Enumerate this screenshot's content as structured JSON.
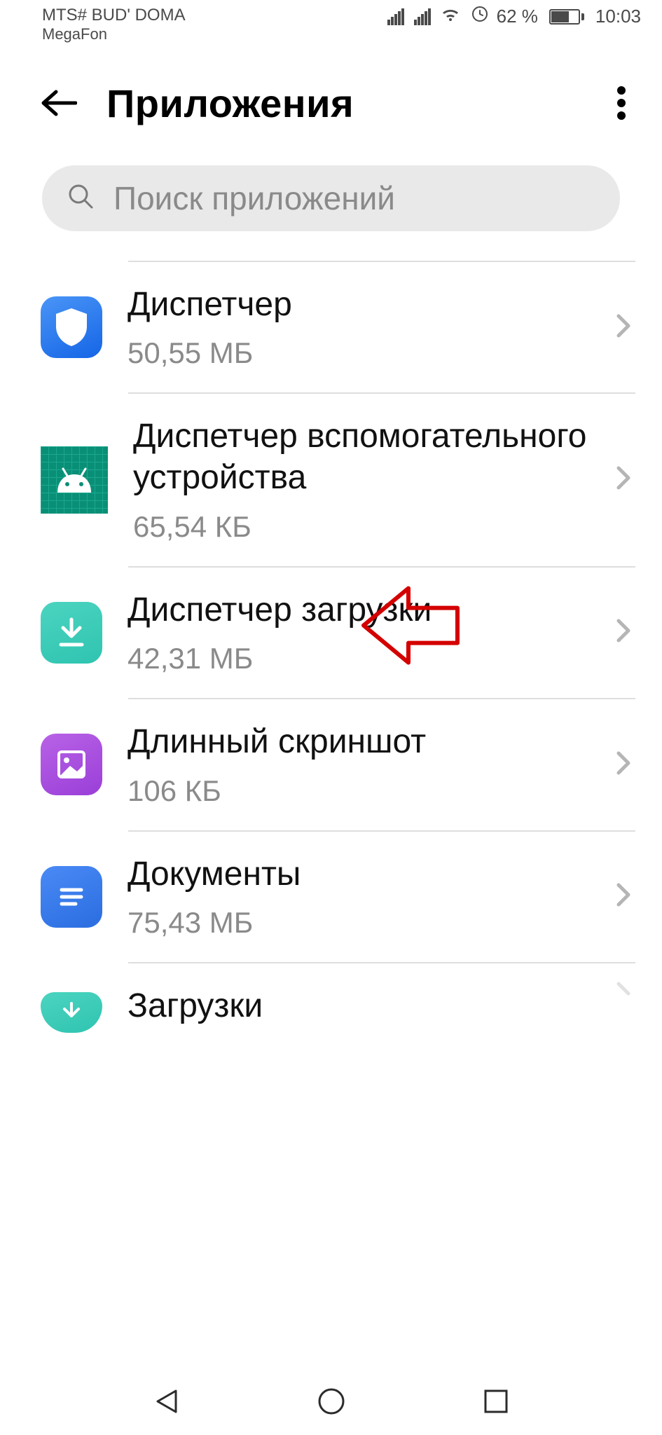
{
  "status": {
    "carrier1": "MTS# BUD' DOMA",
    "carrier2": "MegaFon",
    "battery_pct": "62 %",
    "time": "10:03"
  },
  "header": {
    "title": "Приложения"
  },
  "search": {
    "placeholder": "Поиск приложений"
  },
  "apps": [
    {
      "name": "Диспетчер",
      "size": "50,55 МБ"
    },
    {
      "name": "Диспетчер вспомогательного устройства",
      "size": "65,54 КБ"
    },
    {
      "name": "Диспетчер загрузки",
      "size": "42,31 МБ"
    },
    {
      "name": "Длинный скриншот",
      "size": "106 КБ"
    },
    {
      "name": "Документы",
      "size": "75,43 МБ"
    },
    {
      "name": "Загрузки",
      "size": ""
    }
  ]
}
